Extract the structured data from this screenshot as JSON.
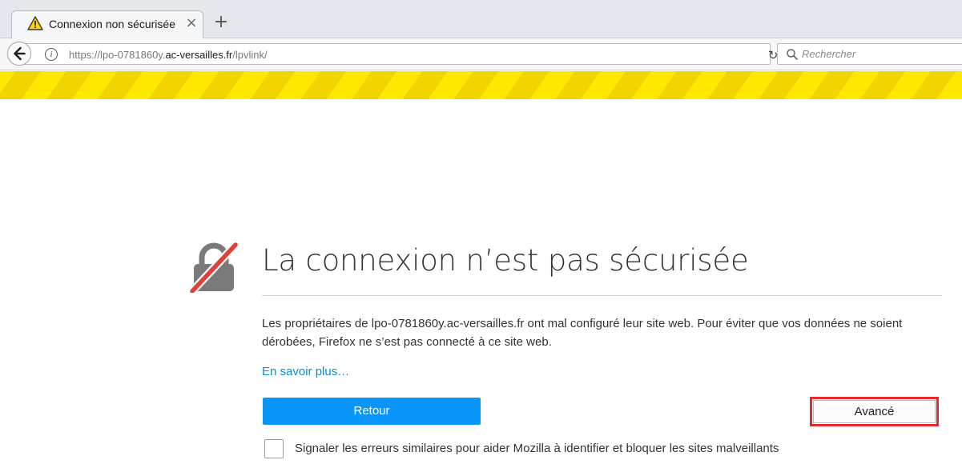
{
  "tab": {
    "title": "Connexion non sécurisée",
    "close_icon": "×",
    "new_tab_icon": "+"
  },
  "navbar": {
    "url_prefix": "https://lpo-0781860y.",
    "url_domain": "ac-versailles.fr",
    "url_path": "/lpvlink/",
    "info_icon": "i",
    "reload_icon": "↻",
    "search_placeholder": "Rechercher"
  },
  "error_page": {
    "title": "La connexion n’est pas sécurisée",
    "description": "Les propriétaires de lpo-0781860y.ac-versailles.fr ont mal configuré leur site web. Pour éviter que vos données ne soient dérobées, Firefox ne s’est pas connecté à ce site web.",
    "learn_more": "En savoir plus…",
    "back_button": "Retour",
    "advanced_button": "Avancé",
    "report_checkbox_label": "Signaler les erreurs similaires pour aider Mozilla à identifier et bloquer les sites malveillants"
  },
  "colors": {
    "primary_button": "#0996f8",
    "link": "#0a8ed6",
    "warning_stripe": "#ffe900",
    "highlight": "#e8282c"
  }
}
